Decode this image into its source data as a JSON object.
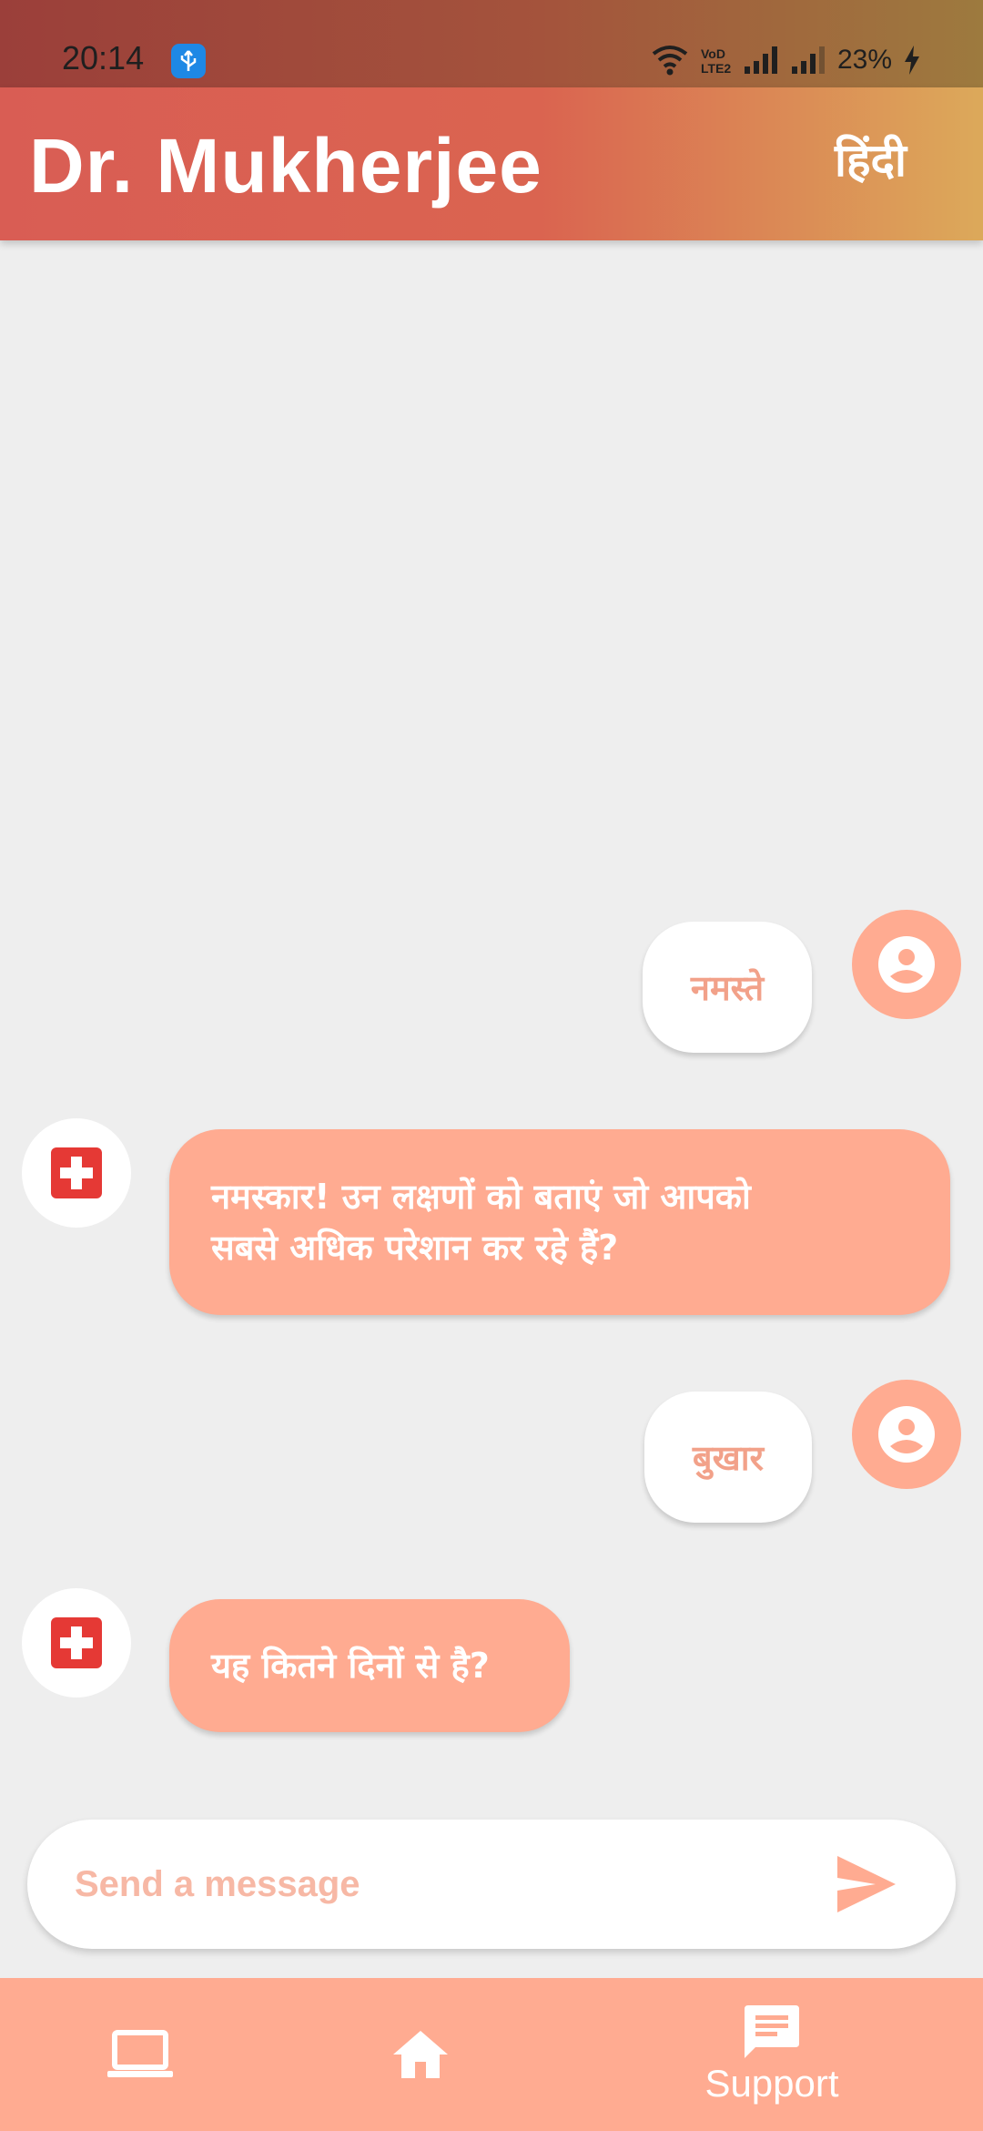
{
  "status_bar": {
    "time": "20:14",
    "battery": "23%",
    "icons": [
      "usb-icon",
      "wifi-icon",
      "volte-icon",
      "signal-icon",
      "signal-icon",
      "charging-icon"
    ]
  },
  "header": {
    "title": "Dr. Mukherjee",
    "language_toggle": "हिंदी"
  },
  "messages": [
    {
      "sender": "user",
      "text": "नमस्ते"
    },
    {
      "sender": "doctor",
      "lines": [
        "नमस्कार! उन लक्षणों को बताएं जो आपको",
        "सबसे अधिक परेशान कर रहे हैं?"
      ]
    },
    {
      "sender": "user",
      "text": "बुखार"
    },
    {
      "sender": "doctor",
      "text": "यह कितने दिनों से है?"
    }
  ],
  "composer": {
    "placeholder": "Send a message",
    "value": ""
  },
  "bottom_nav": {
    "items": [
      {
        "icon": "laptop-icon",
        "label": ""
      },
      {
        "icon": "home-icon",
        "label": ""
      },
      {
        "icon": "chat-icon",
        "label": "Support"
      }
    ]
  },
  "colors": {
    "accent": "#ffab91",
    "header_start": "#d95d54",
    "header_end": "#dca95a",
    "background": "#eeeeee",
    "doctor_icon": "#e53935"
  }
}
